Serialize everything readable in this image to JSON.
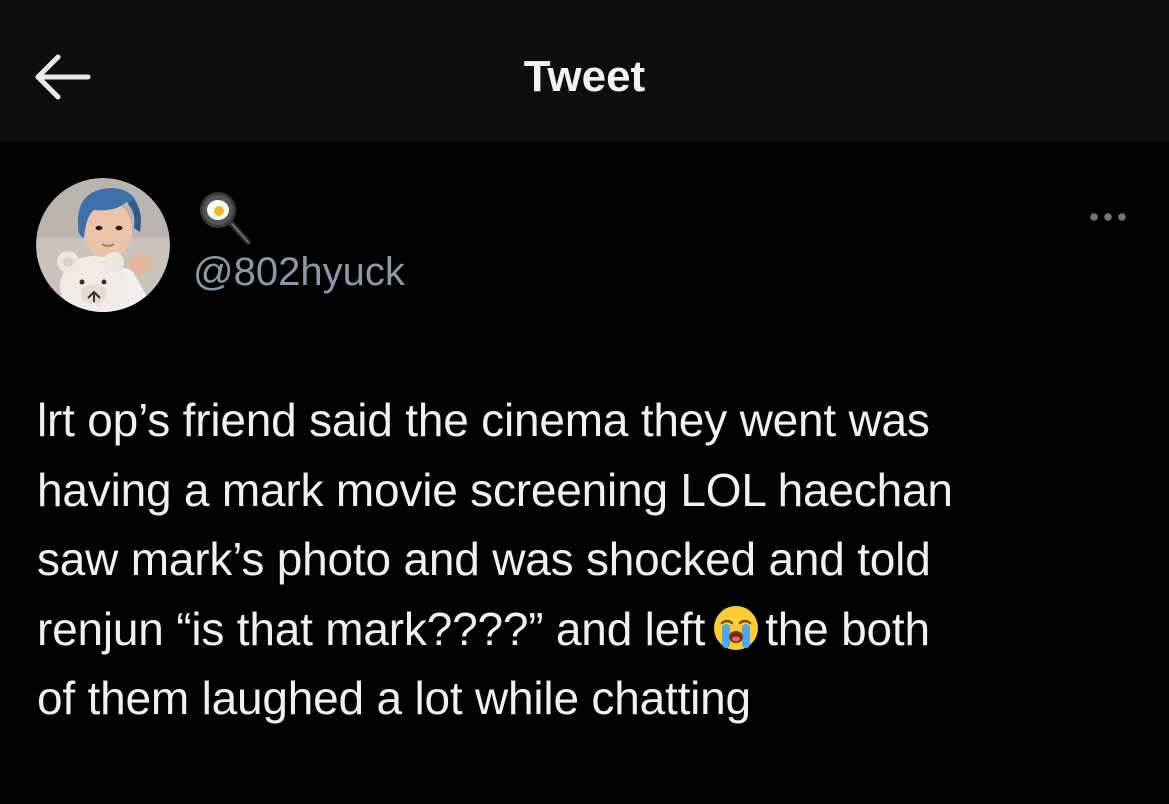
{
  "header": {
    "title": "Tweet",
    "back_icon": "arrow-left-icon",
    "background": "#0e0e0e"
  },
  "author": {
    "display_name_icon": "frying-pan-egg-icon",
    "handle": "@802hyuck",
    "avatar": "avatar"
  },
  "more_icon": "more-horizontal-icon",
  "tweet": {
    "lines": [
      "lrt op’s friend said the cinema they went was",
      "having a mark movie screening LOL haechan",
      "saw mark’s photo and was shocked and told",
      "renjun “is that mark????” and left",
      "the both",
      "of them laughed a lot while chatting"
    ],
    "emoji": "loudly-crying-face-icon"
  },
  "colors": {
    "background": "#000000",
    "text": "#eef0f1",
    "secondary_text": "#8b98a5"
  }
}
